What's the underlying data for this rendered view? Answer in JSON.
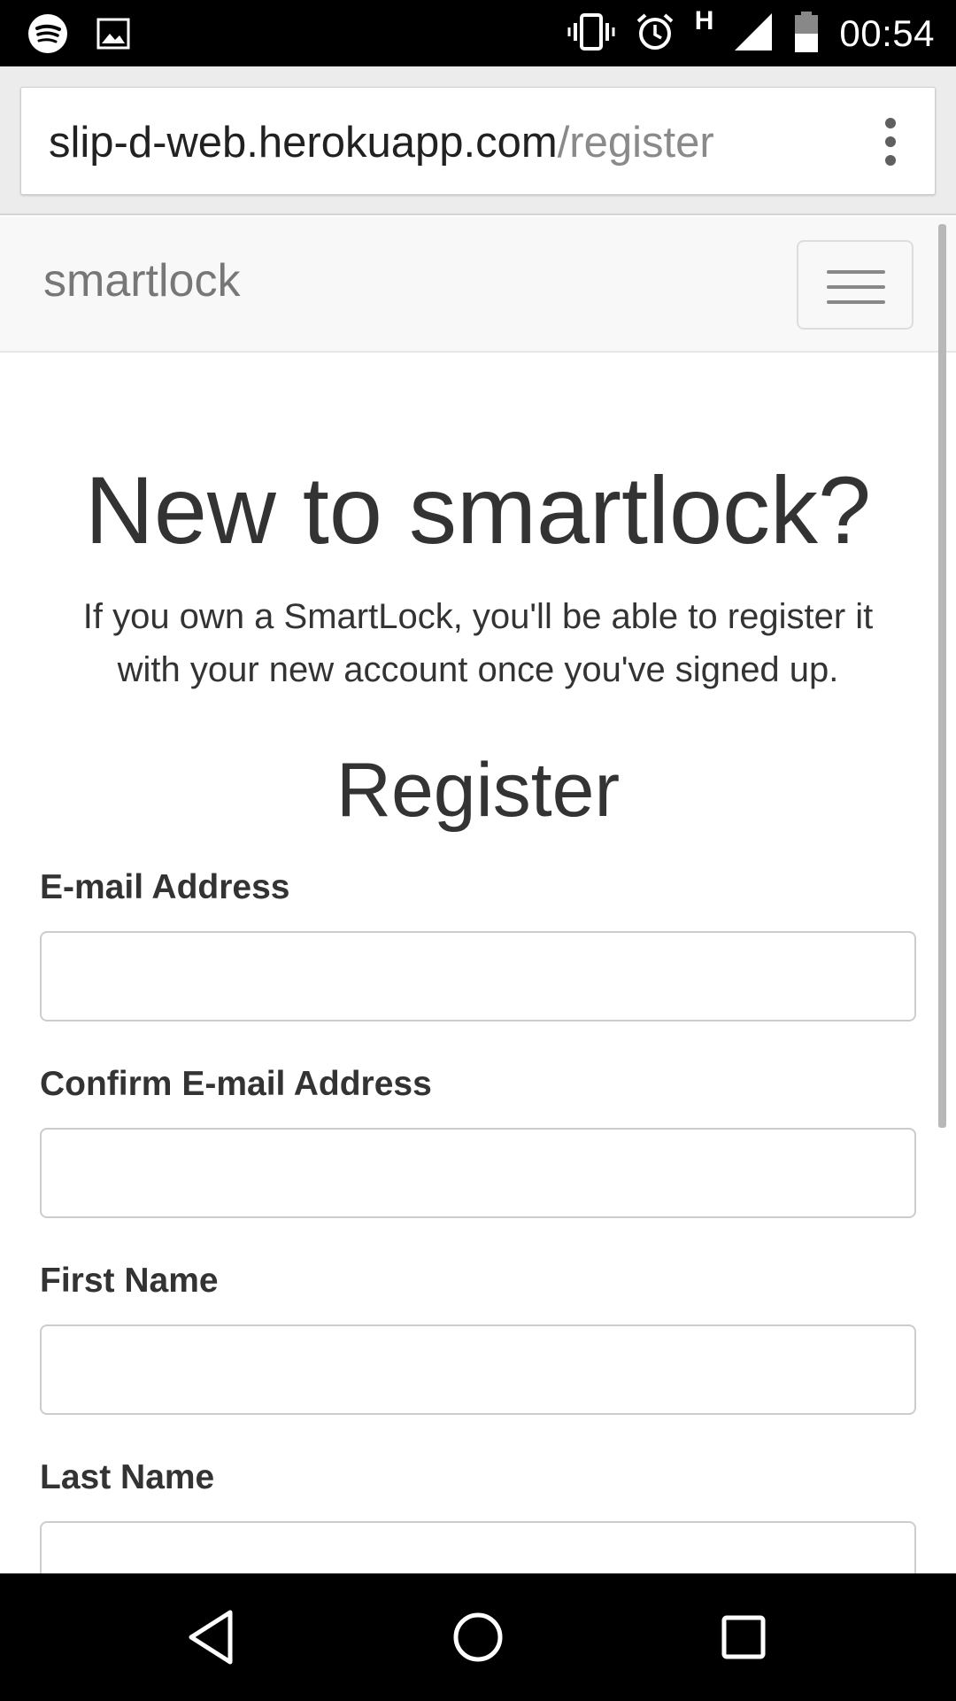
{
  "status_bar": {
    "time": "00:54",
    "network_type": "H",
    "left_icons": [
      "spotify-icon",
      "image-icon"
    ],
    "right_icons": [
      "vibrate-icon",
      "alarm-icon",
      "signal-icon",
      "battery-icon"
    ]
  },
  "browser": {
    "url_host": "slip-d-web.herokuapp.com",
    "url_path": "/register"
  },
  "navbar": {
    "brand": "smartlock"
  },
  "hero": {
    "title": "New to smartlock?",
    "subtitle": "If you own a SmartLock, you'll be able to register it with your new account once you've signed up."
  },
  "form": {
    "title": "Register",
    "fields": [
      {
        "label": "E-mail Address",
        "value": ""
      },
      {
        "label": "Confirm E-mail Address",
        "value": ""
      },
      {
        "label": "First Name",
        "value": ""
      },
      {
        "label": "Last Name",
        "value": ""
      }
    ]
  },
  "colors": {
    "navbar_bg": "#f8f8f8",
    "text": "#333333",
    "brand": "#777777"
  }
}
